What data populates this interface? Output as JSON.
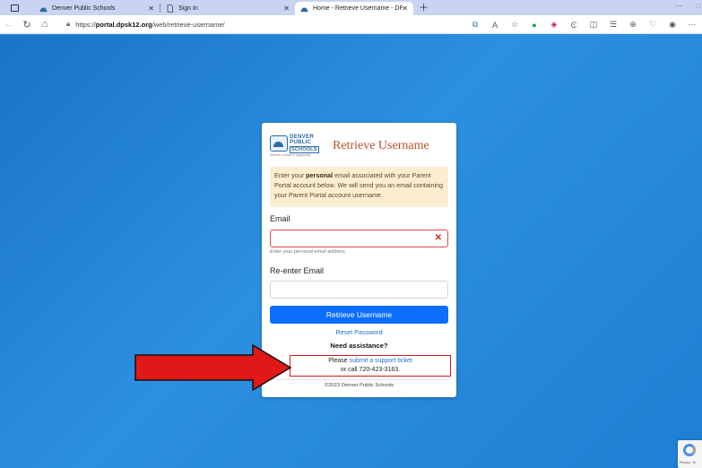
{
  "browser": {
    "tabs": [
      {
        "title": "Denver Public Schools",
        "active": false
      },
      {
        "title": "Sign In",
        "active": false
      },
      {
        "title": "Home - Retrieve Username - DP",
        "active": true
      }
    ],
    "url_prefix": "https://",
    "url_host": "portal.dpsk12.org",
    "url_path": "/web/retrieve-username/"
  },
  "logo": {
    "line1": "DENVER",
    "line2": "PUBLIC",
    "line3": "SCHOOLS",
    "tagline": "Discover a World of Opportunity"
  },
  "card": {
    "title": "Retrieve Username",
    "notice_pre": "Enter your ",
    "notice_bold": "personal",
    "notice_post": " email associated with your Parent Portal account below. We will send you an email containing your Parent Portal account username.",
    "email_label": "Email",
    "email_value": "",
    "email_hint": "Enter your personal email address.",
    "reemail_label": "Re-enter Email",
    "reemail_value": "",
    "submit_label": "Retrieve Username",
    "reset_link": "Reset Password",
    "need_assistance": "Need assistance?",
    "support_pre": "Please ",
    "support_link": "submit a support ticket",
    "support_call": "or call 720-423-3163.",
    "copyright": "©2023 Denver Public Schools"
  },
  "colors": {
    "brand_orange": "#c0502a",
    "primary_button": "#0d6efd",
    "error_red": "#d12a2a",
    "annotation_red": "#e01818"
  }
}
